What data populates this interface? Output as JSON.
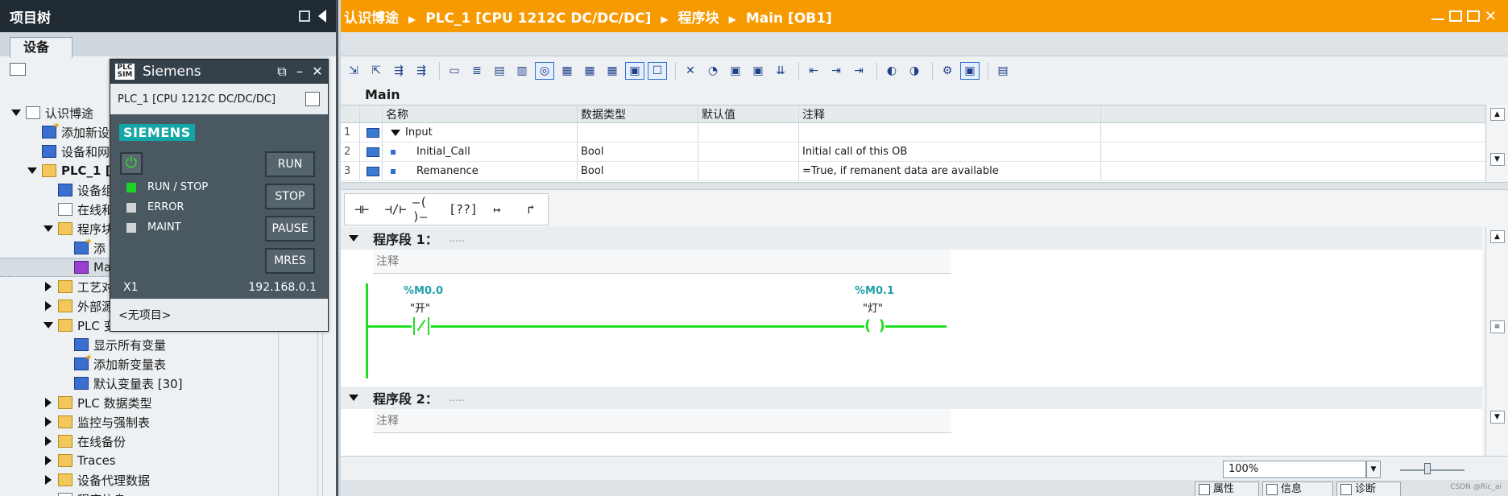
{
  "left_panel": {
    "title": "项目树",
    "tab": "设备",
    "tree": [
      {
        "label": "认识博途",
        "indent": 0,
        "expand": "down",
        "icon": "doc"
      },
      {
        "label": "添加新设",
        "indent": 1,
        "expand": "none",
        "icon": "blue-star"
      },
      {
        "label": "设备和网",
        "indent": 1,
        "expand": "none",
        "icon": "network"
      },
      {
        "label": "PLC_1 [C",
        "indent": 1,
        "expand": "down",
        "icon": "folder",
        "bold": true
      },
      {
        "label": "设备组",
        "indent": 2,
        "expand": "none",
        "icon": "blue"
      },
      {
        "label": "在线和",
        "indent": 2,
        "expand": "none",
        "icon": "doc"
      },
      {
        "label": "程序块",
        "indent": 2,
        "expand": "down",
        "icon": "folder"
      },
      {
        "label": "添",
        "indent": 3,
        "expand": "none",
        "icon": "blue-star"
      },
      {
        "label": "Ma",
        "indent": 3,
        "expand": "none",
        "icon": "purple",
        "selected": true
      },
      {
        "label": "工艺对",
        "indent": 2,
        "expand": "right",
        "icon": "folder"
      },
      {
        "label": "外部源",
        "indent": 2,
        "expand": "right",
        "icon": "folder"
      },
      {
        "label": "PLC 变",
        "indent": 2,
        "expand": "down",
        "icon": "folder"
      },
      {
        "label": "显示所有变量",
        "indent": 3,
        "expand": "none",
        "icon": "blue"
      },
      {
        "label": "添加新变量表",
        "indent": 3,
        "expand": "none",
        "icon": "blue-star"
      },
      {
        "label": "默认变量表 [30]",
        "indent": 3,
        "expand": "none",
        "icon": "blue"
      },
      {
        "label": "PLC 数据类型",
        "indent": 2,
        "expand": "right",
        "icon": "folder"
      },
      {
        "label": "监控与强制表",
        "indent": 2,
        "expand": "right",
        "icon": "folder"
      },
      {
        "label": "在线备份",
        "indent": 2,
        "expand": "right",
        "icon": "folder"
      },
      {
        "label": "Traces",
        "indent": 2,
        "expand": "right",
        "icon": "folder"
      },
      {
        "label": "设备代理数据",
        "indent": 2,
        "expand": "right",
        "icon": "folder"
      },
      {
        "label": "程序信息",
        "indent": 2,
        "expand": "none",
        "icon": "doc"
      }
    ]
  },
  "simulator": {
    "title": "Siemens",
    "logo_text": "PLC SIM",
    "project_line": "PLC_1 [CPU 1212C DC/DC/DC]",
    "brand": "SIEMENS",
    "leds": [
      {
        "label": "RUN / STOP",
        "on": true
      },
      {
        "label": "ERROR",
        "on": false
      },
      {
        "label": "MAINT",
        "on": false
      }
    ],
    "buttons": [
      "RUN",
      "STOP",
      "PAUSE",
      "MRES"
    ],
    "interface_name": "X1",
    "ip": "192.168.0.1",
    "footer": "<无项目>"
  },
  "editor": {
    "breadcrumb": [
      "认识博途",
      "PLC_1 [CPU 1212C DC/DC/DC]",
      "程序块",
      "Main [OB1]"
    ],
    "block_name": "Main",
    "columns": [
      "名称",
      "数据类型",
      "默认值",
      "注释"
    ],
    "rows": [
      {
        "no": "1",
        "name": "Input",
        "type": "",
        "default": "",
        "comment": ""
      },
      {
        "no": "2",
        "name": "Initial_Call",
        "type": "Bool",
        "default": "",
        "comment": "Initial call of this OB"
      },
      {
        "no": "3",
        "name": "Remanence",
        "type": "Bool",
        "default": "",
        "comment": "=True, if remanent data are available"
      }
    ],
    "lad_instructions": [
      "⊣⊢",
      "⊣/⊢",
      "–( )–",
      "[??]",
      "↦",
      "↱"
    ],
    "networks": [
      {
        "title": "程序段 1：",
        "dots": ".....",
        "comment": "注释",
        "contact": {
          "address": "%M0.0",
          "tag": "\"开\""
        },
        "coil": {
          "address": "%M0.1",
          "tag": "\"灯\""
        }
      },
      {
        "title": "程序段 2：",
        "dots": ".....",
        "comment": "注释"
      }
    ],
    "zoom": "100%",
    "bottom_tabs": [
      "属性",
      "信息",
      "诊断"
    ],
    "watermark": "CSDN @Ric_ai"
  },
  "colors": {
    "accent_orange": "#f79a00",
    "title_dark": "#1f2a33",
    "ladder_green": "#22dd22",
    "address_teal": "#20a0a8",
    "siemens_teal": "#12a6a6"
  }
}
